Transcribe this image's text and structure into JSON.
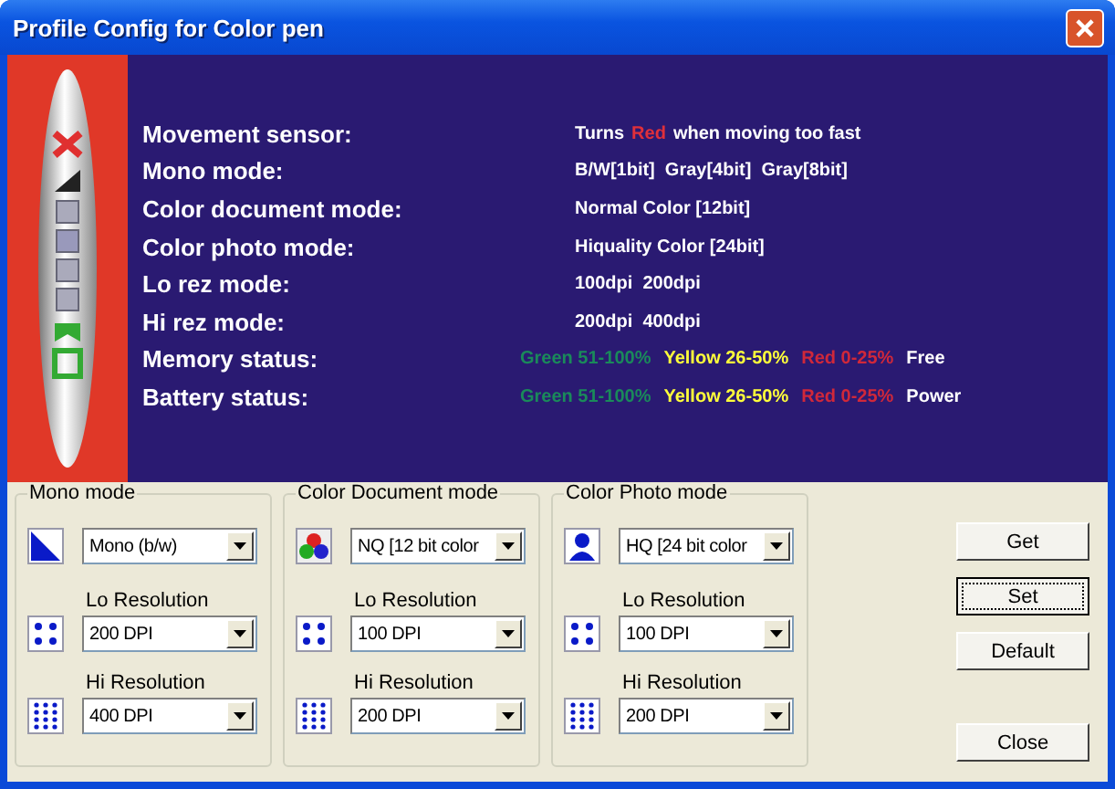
{
  "window": {
    "title": "Profile Config for Color pen"
  },
  "banner": {
    "rows": [
      {
        "label": "Movement sensor:",
        "kind": "sentence",
        "parts": [
          {
            "text": "Turns",
            "color": "#ffffff"
          },
          {
            "text": "Red",
            "color": "#e0303a"
          },
          {
            "text": "when moving too fast",
            "color": "#ffffff"
          }
        ]
      },
      {
        "label": "Mono mode:",
        "kind": "sentence",
        "parts": [
          {
            "text": "B/W[1bit]  Gray[4bit]  Gray[8bit]",
            "color": "#ffffff"
          }
        ]
      },
      {
        "label": "Color document mode:",
        "kind": "sentence",
        "parts": [
          {
            "text": "Normal Color [12bit]",
            "color": "#ffffff"
          }
        ]
      },
      {
        "label": "Color photo mode:",
        "kind": "sentence",
        "parts": [
          {
            "text": "Hiquality Color [24bit]",
            "color": "#ffffff"
          }
        ]
      },
      {
        "label": "Lo rez mode:",
        "kind": "sentence",
        "parts": [
          {
            "text": "100dpi  200dpi",
            "color": "#ffffff"
          }
        ]
      },
      {
        "label": "Hi rez mode:",
        "kind": "sentence",
        "parts": [
          {
            "text": "200dpi  400dpi",
            "color": "#ffffff"
          }
        ]
      },
      {
        "label": "Memory status:",
        "kind": "legend",
        "parts": [
          {
            "text": "Green 51-100%",
            "color": "#1a8a5a"
          },
          {
            "text": "Yellow 26-50%",
            "color": "#ffff3a"
          },
          {
            "text": "Red 0-25%",
            "color": "#d0283a"
          },
          {
            "text": "Free",
            "color": "#ffffff"
          }
        ]
      },
      {
        "label": "Battery status:",
        "kind": "legend",
        "parts": [
          {
            "text": "Green 51-100%",
            "color": "#1a8a5a"
          },
          {
            "text": "Yellow 26-50%",
            "color": "#ffff3a"
          },
          {
            "text": "Red 0-25%",
            "color": "#d0283a"
          },
          {
            "text": "Power",
            "color": "#ffffff"
          }
        ]
      }
    ]
  },
  "groups": [
    {
      "title": "Mono mode",
      "kind": "mono",
      "mode": "Mono (b/w)",
      "lo_label": "Lo Resolution",
      "lo": "200 DPI",
      "hi_label": "Hi Resolution",
      "hi": "400 DPI"
    },
    {
      "title": "Color Document mode",
      "kind": "colors",
      "mode": "NQ [12 bit color",
      "lo_label": "Lo Resolution",
      "lo": "100 DPI",
      "hi_label": "Hi Resolution",
      "hi": "200 DPI"
    },
    {
      "title": "Color Photo mode",
      "kind": "person",
      "mode": "HQ [24 bit color",
      "lo_label": "Lo Resolution",
      "lo": "100 DPI",
      "hi_label": "Hi Resolution",
      "hi": "200 DPI"
    }
  ],
  "buttons": [
    {
      "label": "Get",
      "focused": false
    },
    {
      "label": "Set",
      "focused": true
    },
    {
      "label": "Default",
      "focused": false
    },
    {
      "label": "Close",
      "focused": false
    }
  ]
}
